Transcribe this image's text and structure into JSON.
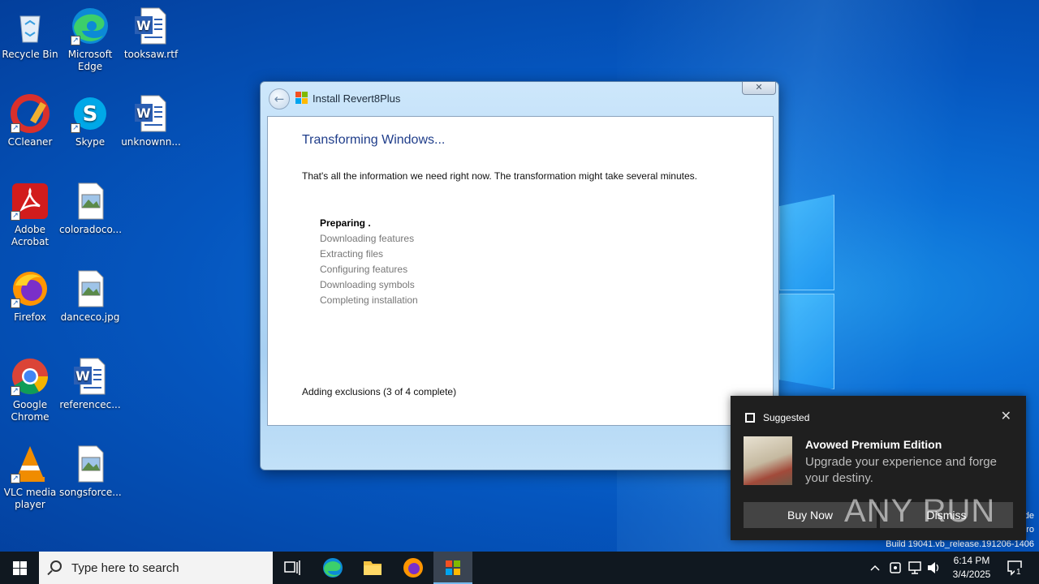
{
  "desktop": {
    "icons": [
      {
        "label": "Recycle Bin",
        "icon": "recycle-bin-icon"
      },
      {
        "label": "Microsoft Edge",
        "icon": "edge-icon"
      },
      {
        "label": "tooksaw.rtf",
        "icon": "word-document-icon"
      },
      {
        "label": "CCleaner",
        "icon": "ccleaner-icon"
      },
      {
        "label": "Skype",
        "icon": "skype-icon"
      },
      {
        "label": "unknownn...",
        "icon": "word-document-icon"
      },
      {
        "label": "Adobe Acrobat",
        "icon": "acrobat-icon"
      },
      {
        "label": "coloradoco...",
        "icon": "image-file-icon"
      },
      {
        "label": "Firefox",
        "icon": "firefox-icon"
      },
      {
        "label": "danceco.jpg",
        "icon": "image-file-icon"
      },
      {
        "label": "Google Chrome",
        "icon": "chrome-icon"
      },
      {
        "label": "referencec...",
        "icon": "word-document-icon"
      },
      {
        "label": "VLC media player",
        "icon": "vlc-icon"
      },
      {
        "label": "songsforce...",
        "icon": "image-file-icon"
      }
    ]
  },
  "installer": {
    "title": "Install Revert8Plus",
    "close_label": "✕",
    "heading": "Transforming Windows...",
    "info": "That's all the information we need right now. The transformation might take several minutes.",
    "steps": [
      "Preparing .",
      "Downloading features",
      "Extracting files",
      "Configuring features",
      "Downloading symbols",
      "Completing installation"
    ],
    "status": "Adding exclusions (3 of 4 complete)"
  },
  "watermark": {
    "line1": "de",
    "line2": "ro",
    "build": "Build 19041.vb_release.191206-1406"
  },
  "toast": {
    "app_name": "Suggested",
    "headline": "Avowed Premium Edition",
    "body": "Upgrade your experience and forge your destiny.",
    "buy_label": "Buy Now",
    "dismiss_label": "Dismiss"
  },
  "anyrun_logo": "ANY RUN",
  "taskbar": {
    "search_placeholder": "Type here to search",
    "time": "6:14 PM",
    "date": "3/4/2025",
    "notification_count": "1"
  }
}
